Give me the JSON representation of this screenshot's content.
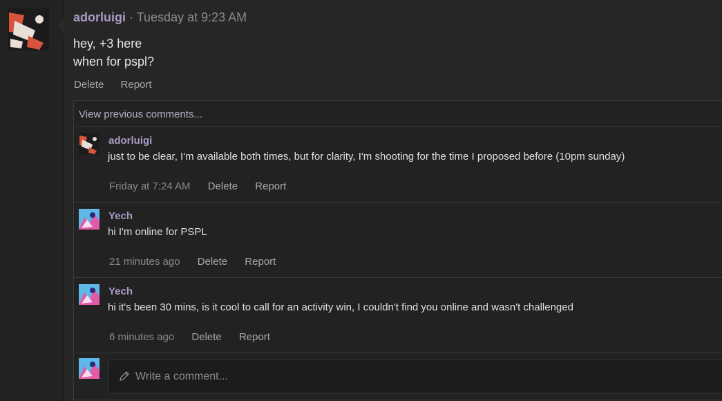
{
  "post": {
    "author": "adorluigi",
    "separator": "·",
    "timestamp": "Tuesday at 9:23 AM",
    "body_lines": [
      "hey, +3 here",
      "when for pspl?"
    ],
    "actions": [
      "Delete",
      "Report"
    ]
  },
  "comments": {
    "view_previous": "View previous comments...",
    "items": [
      {
        "author": "adorluigi",
        "text": "just to be clear, I'm available both times, but for clarity, I'm shooting for the time I proposed before (10pm sunday)",
        "time": "Friday at 7:24 AM",
        "delete": "Delete",
        "report": "Report"
      },
      {
        "author": "Yech",
        "text": "hi I'm online for PSPL",
        "time": "21 minutes ago",
        "delete": "Delete",
        "report": "Report"
      },
      {
        "author": "Yech",
        "text": "hi it's been 30 mins, is it cool to call for an activity win, I couldn't find you online and wasn't challenged",
        "time": "6 minutes ago",
        "delete": "Delete",
        "report": "Report"
      }
    ],
    "composer_placeholder": "Write a comment..."
  },
  "colors": {
    "background": "#1a1a1a",
    "panel": "#262626",
    "username": "#a99ac4",
    "muted": "#8a8a8a"
  },
  "icons": {
    "composer": "pencil-icon"
  }
}
